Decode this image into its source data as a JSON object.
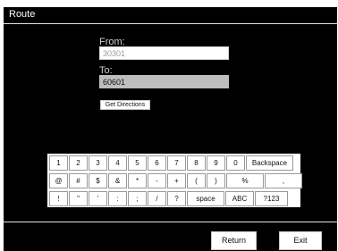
{
  "window": {
    "title": "Route"
  },
  "form": {
    "from_label": "From:",
    "from_value": "30301",
    "to_label": "To:",
    "to_value": "60601",
    "get_directions_label": "Get Directions"
  },
  "keyboard": {
    "row1": [
      "1",
      "2",
      "3",
      "4",
      "5",
      "6",
      "7",
      "8",
      "9",
      "0",
      "Backspace"
    ],
    "row2": [
      "@",
      "#",
      "$",
      "&",
      "*",
      "-",
      "+",
      "(",
      ")",
      "%",
      ","
    ],
    "row3": [
      "!",
      "\"",
      "'",
      ":",
      ";",
      "/",
      "?",
      "space",
      "ABC",
      "?123"
    ]
  },
  "footer": {
    "return_label": "Return",
    "exit_label": "Exit"
  },
  "colors": {
    "background": "#000000",
    "field_active": "#ffffff",
    "field_filled": "#bdbdbd"
  }
}
